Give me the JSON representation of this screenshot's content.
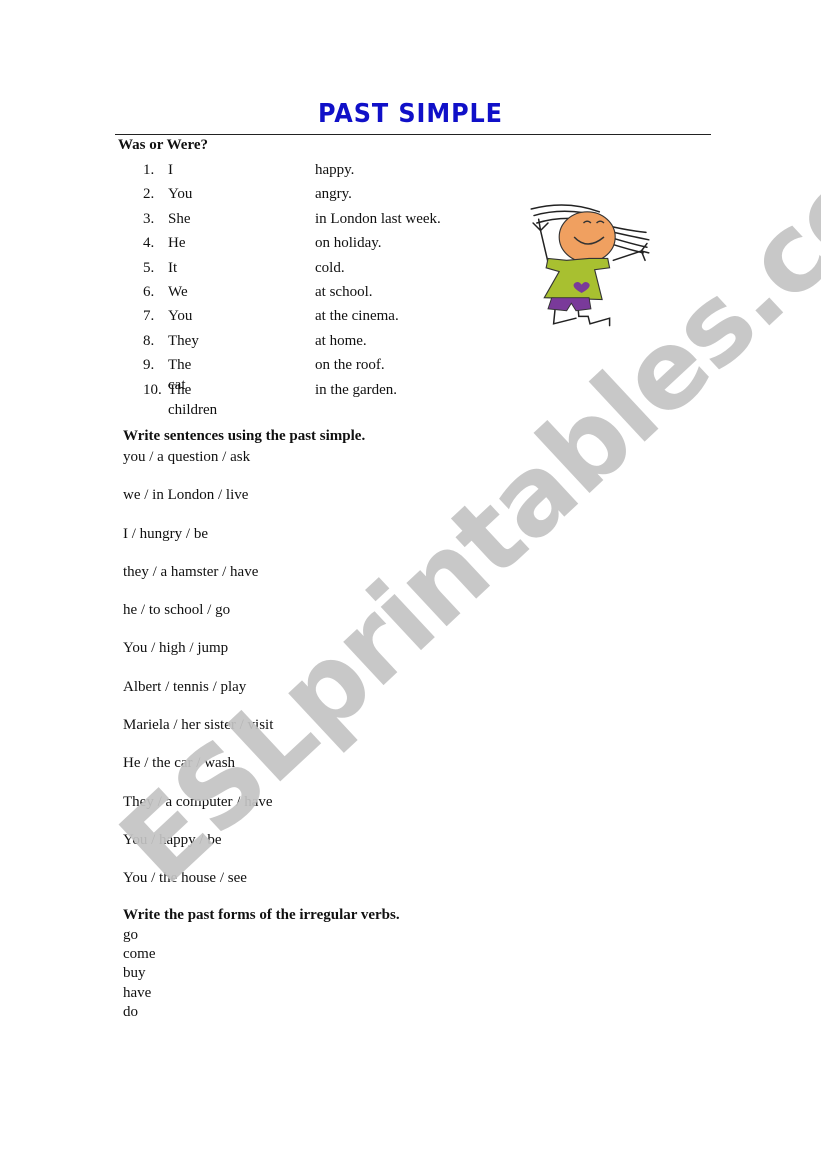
{
  "title": "PAST SIMPLE",
  "section1": {
    "heading": "Was or Were?",
    "items": [
      {
        "num": "1.",
        "subject": "I",
        "rest": "happy."
      },
      {
        "num": "2.",
        "subject": "You",
        "rest": "angry."
      },
      {
        "num": "3.",
        "subject": "She",
        "rest": "in London last week."
      },
      {
        "num": "4.",
        "subject": "He",
        "rest": "on holiday."
      },
      {
        "num": "5.",
        "subject": "It",
        "rest": "cold."
      },
      {
        "num": "6.",
        "subject": "We",
        "rest": "at school."
      },
      {
        "num": "7.",
        "subject": "You",
        "rest": "at the cinema."
      },
      {
        "num": "8.",
        "subject": "They",
        "rest": "at home."
      },
      {
        "num": "9.",
        "subject": "The cat",
        "rest": "on the roof."
      },
      {
        "num": "10.",
        "subject": "The children",
        "rest": "in the garden."
      }
    ]
  },
  "section2": {
    "heading": "Write sentences using the past simple.",
    "items": [
      "you / a question / ask",
      "we / in London / live",
      "I / hungry / be",
      "they / a hamster / have",
      "he / to school / go",
      "You / high / jump",
      "Albert / tennis / play",
      "Mariela / her sister / visit",
      "He / the car / wash",
      "They / a computer / have",
      "You / happy / be",
      "You / the house / see"
    ]
  },
  "section3": {
    "heading": "Write the past forms of the irregular verbs.",
    "items": [
      "go",
      "come",
      "buy",
      "have",
      "do"
    ]
  },
  "illustration": {
    "icon": "cartoon-child-icon",
    "colors": {
      "face": "#f0a060",
      "shirt": "#a8c030",
      "shorts": "#7a3a9a",
      "heart": "#7a3a9a"
    }
  },
  "watermark": "ESLprintables.com",
  "colors": {
    "title": "#1010c8",
    "text": "#111111",
    "watermark": "#c4c4c4"
  }
}
